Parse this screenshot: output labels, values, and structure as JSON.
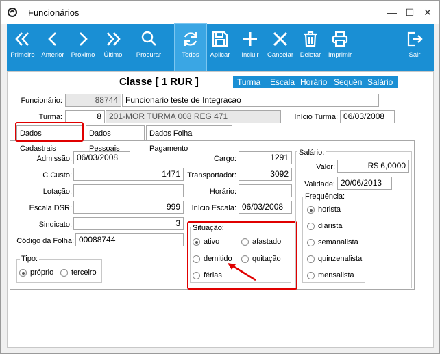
{
  "window": {
    "title": "Funcionários",
    "minimize": "—",
    "maximize": "☐",
    "close": "✕"
  },
  "toolbar": [
    {
      "name": "primeiro",
      "label": "Primeiro",
      "icon": "double-chevron-left-icon"
    },
    {
      "name": "anterior",
      "label": "Anterior",
      "icon": "chevron-left-icon"
    },
    {
      "name": "proximo",
      "label": "Próximo",
      "icon": "chevron-right-icon"
    },
    {
      "name": "ultimo",
      "label": "Último",
      "icon": "double-chevron-right-icon"
    },
    {
      "name": "procurar",
      "label": "Procurar",
      "icon": "search-icon"
    },
    {
      "name": "todos",
      "label": "Todos",
      "icon": "refresh-icon"
    },
    {
      "name": "aplicar",
      "label": "Aplicar",
      "icon": "save-icon"
    },
    {
      "name": "incluir",
      "label": "Incluir",
      "icon": "plus-icon"
    },
    {
      "name": "cancelar",
      "label": "Cancelar",
      "icon": "close-icon"
    },
    {
      "name": "deletar",
      "label": "Deletar",
      "icon": "trash-icon"
    },
    {
      "name": "imprimir",
      "label": "Imprimir",
      "icon": "printer-icon"
    },
    {
      "name": "sair",
      "label": "Sair",
      "icon": "exit-icon"
    }
  ],
  "header": {
    "classe": "Classe [ 1 RUR ]",
    "links": [
      "Turma",
      "Escala",
      "Horário",
      "Sequên",
      "Salário"
    ],
    "funcionario_label": "Funcionário:",
    "funcionario_code": "88744",
    "funcionario_name": "Funcionario teste de Integracao",
    "turma_label": "Turma:",
    "turma_code": "8",
    "turma_desc": "201-MOR TURMA 008 REG 471",
    "inicio_turma_label": "Início Turma:",
    "inicio_turma": "06/03/2008"
  },
  "tabs": [
    "Dados Cadastrais",
    "Dados Pessoais",
    "Dados Folha Pagamento"
  ],
  "form": {
    "admissao_label": "Admissão:",
    "admissao": "06/03/2008",
    "ccusto_label": "C.Custo:",
    "ccusto": "1471",
    "lotacao_label": "Lotação:",
    "lotacao": "",
    "escala_dsr_label": "Escala DSR:",
    "escala_dsr": "999",
    "sindicato_label": "Sindicato:",
    "sindicato": "3",
    "codigo_folha_label": "Código da Folha:",
    "codigo_folha": "00088744",
    "cargo_label": "Cargo:",
    "cargo": "1291",
    "transportador_label": "Transportador:",
    "transportador": "3092",
    "horario_label": "Horário:",
    "horario": "",
    "inicio_escala_label": "Início Escala:",
    "inicio_escala": "06/03/2008"
  },
  "tipo": {
    "title": "Tipo:",
    "options": [
      "próprio",
      "terceiro"
    ],
    "selected": "próprio"
  },
  "situacao": {
    "title": "Situação:",
    "options": [
      "ativo",
      "afastado",
      "demitido",
      "quitação",
      "férias"
    ],
    "selected": "ativo"
  },
  "salario": {
    "title": "Salário:",
    "valor_label": "Valor:",
    "valor": "R$ 6,0000",
    "validade_label": "Validade:",
    "validade": "20/06/2013"
  },
  "frequencia": {
    "title": "Frequência:",
    "options": [
      "horista",
      "diarista",
      "semanalista",
      "quinzenalista",
      "mensalista"
    ],
    "selected": "horista"
  },
  "colors": {
    "accent": "#1a8fd4",
    "highlight": "#e00000"
  }
}
